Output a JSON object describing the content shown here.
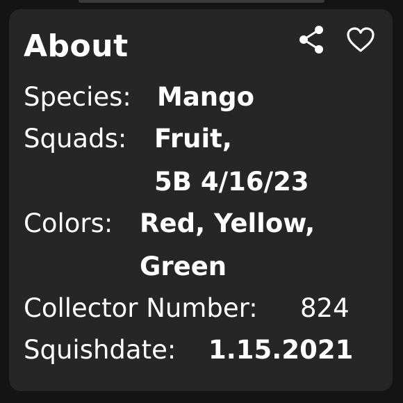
{
  "card": {
    "title": "About",
    "actions": {
      "share_icon": "share-icon",
      "favorite_icon": "heart-outline-icon"
    },
    "fields": {
      "species_label": "Species:",
      "species_value": "Mango",
      "squads_label": "Squads:",
      "squads_value_line1": "Fruit,",
      "squads_value_line2": "5B 4/16/23",
      "colors_label": "Colors:",
      "colors_value_line1": "Red, Yellow,",
      "colors_value_line2": "Green",
      "collector_label": "Collector Number:",
      "collector_value": "824",
      "squishdate_label": "Squishdate:",
      "squishdate_value": "1.15.2021"
    }
  },
  "colors": {
    "background": "#141414",
    "card": "#262626",
    "text": "#ffffff"
  }
}
